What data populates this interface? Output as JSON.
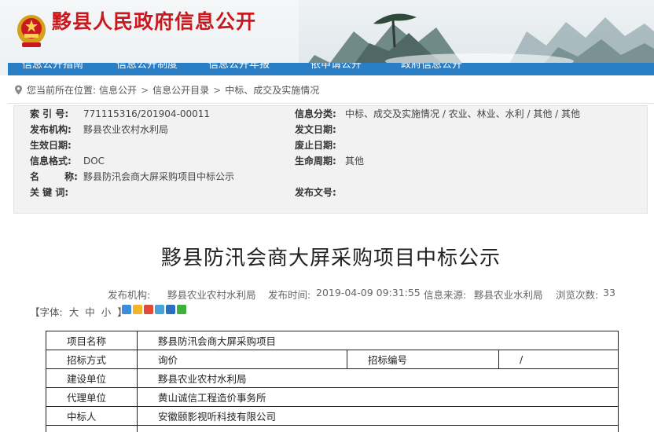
{
  "header": {
    "site_title": "黟县人民政府信息公开",
    "nav": [
      "信息公开指南",
      "信息公开制度",
      "信息公开年报",
      "依申请公开",
      "政府信息公开"
    ]
  },
  "breadcrumb": {
    "prefix": "您当前所在位置:",
    "items": [
      "信息公开",
      "信息公开目录",
      "中标、成交及实施情况"
    ]
  },
  "meta": {
    "index_label": "索 引 号:",
    "index_value": "771115316/201904-00011",
    "category_label": "信息分类:",
    "category_value": "中标、成交及实施情况 / 农业、林业、水利 / 其他 / 其他",
    "org_label": "发布机构:",
    "org_value": "黟县农业农村水利局",
    "doc_date_label": "发文日期:",
    "doc_date_value": "",
    "effective_label": "生效日期:",
    "effective_value": "",
    "abolish_label": "废止日期:",
    "abolish_value": "",
    "format_label": "信息格式:",
    "format_value": "DOC",
    "lifecycle_label": "生命周期:",
    "lifecycle_value": "其他",
    "name_label": "名 称:",
    "name_value": "黟县防汛会商大屏采购项目中标公示",
    "keywords_label": "关 键 词:",
    "keywords_value": "",
    "doc_no_label": "发布文号:",
    "doc_no_value": ""
  },
  "article": {
    "title": "黟县防汛会商大屏采购项目中标公示",
    "org_label": "发布机构:",
    "org_value": "黟县农业农村水利局",
    "time_label": "发布时间:",
    "time_value": "2019-04-09 09:31:55",
    "source_label": "信息来源:",
    "source_value": "黟县农业水利局",
    "views_label": "浏览次数:",
    "views_value": "33"
  },
  "font_size": {
    "open": "【字体:",
    "large": "大",
    "medium": "中",
    "small": "小",
    "close": "】"
  },
  "share_icons": [
    "more-share-icon",
    "qzone-icon",
    "weibo-icon",
    "tencent-weibo-icon",
    "renren-icon",
    "wechat-icon"
  ],
  "table": {
    "rows": [
      [
        "项目名称",
        "黟县防汛会商大屏采购项目"
      ],
      [
        "招标方式",
        "询价",
        "招标编号",
        "/"
      ],
      [
        "建设单位",
        "黟县农业农村水利局"
      ],
      [
        "代理单位",
        "黄山诚信工程造价事务所"
      ],
      [
        "中标人",
        "安徽颐影视听科技有限公司"
      ]
    ]
  },
  "colors": {
    "title_red": "#c9181e",
    "nav_blue": "#2a7ec5"
  }
}
